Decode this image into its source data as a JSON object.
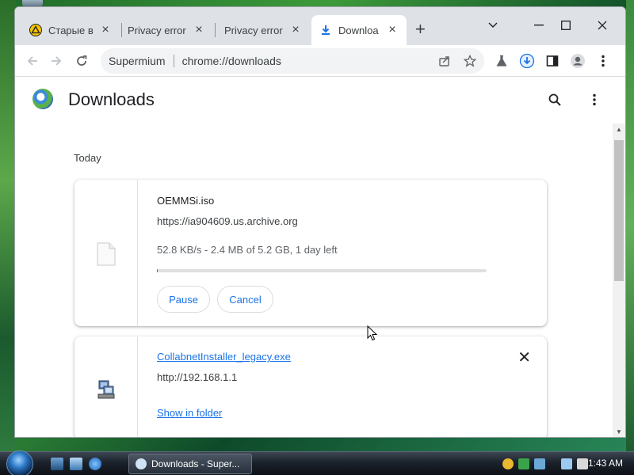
{
  "browser": {
    "tabs": [
      {
        "label": "Старые в",
        "active": false
      },
      {
        "label": "Privacy error",
        "active": false
      },
      {
        "label": "Privacy error",
        "active": false
      },
      {
        "label": "Downloa",
        "active": true
      }
    ],
    "omnibox": {
      "site": "Supermium",
      "url": "chrome://downloads"
    }
  },
  "page": {
    "title": "Downloads",
    "section": "Today",
    "downloads": [
      {
        "filename": "OEMMSi.iso",
        "url": "https://ia904609.us.archive.org",
        "status": "52.8 KB/s - 2.4 MB of 5.2 GB, 1 day left",
        "progress_fraction": 0.0005,
        "pause_label": "Pause",
        "cancel_label": "Cancel"
      },
      {
        "filename": "CollabnetInstaller_legacy.exe",
        "url": "http://192.168.1.1",
        "action_label": "Show in folder",
        "remove_glyph": "✕"
      }
    ]
  },
  "taskbar": {
    "task_label": "Downloads - Super...",
    "clock": "1:43 AM"
  },
  "colors": {
    "accent": "#1a73e8",
    "tabstrip": "#dee1e6"
  }
}
